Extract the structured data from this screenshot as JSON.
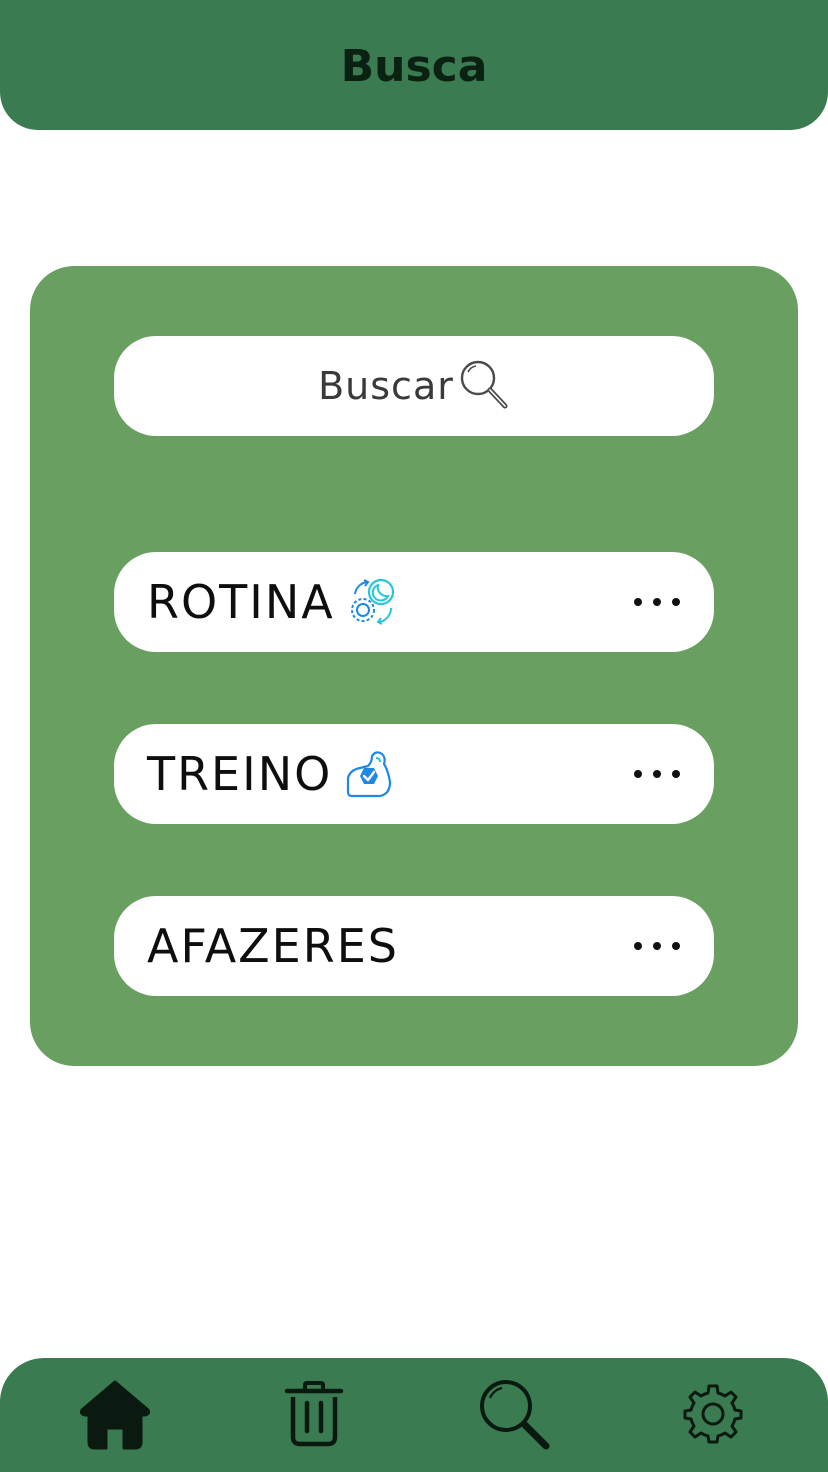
{
  "header": {
    "title": "Busca"
  },
  "search": {
    "label": "Buscar",
    "icon": "magnifier-icon"
  },
  "items": [
    {
      "label": "ROTINA",
      "emoji_icon": "day-night-cycle-icon",
      "more_icon": "more-dots-icon"
    },
    {
      "label": "TREINO",
      "emoji_icon": "flexed-arm-icon",
      "more_icon": "more-dots-icon"
    },
    {
      "label": "AFAZERES",
      "emoji_icon": "",
      "more_icon": "more-dots-icon"
    }
  ],
  "bottom_nav": {
    "items": [
      {
        "icon": "home-icon"
      },
      {
        "icon": "trash-icon"
      },
      {
        "icon": "search-icon"
      },
      {
        "icon": "gear-icon"
      }
    ]
  },
  "colors": {
    "header_bg": "#3b7b51",
    "panel_bg": "#69a062",
    "title_text": "#0b2112",
    "nav_icon": "#0b1a10"
  }
}
